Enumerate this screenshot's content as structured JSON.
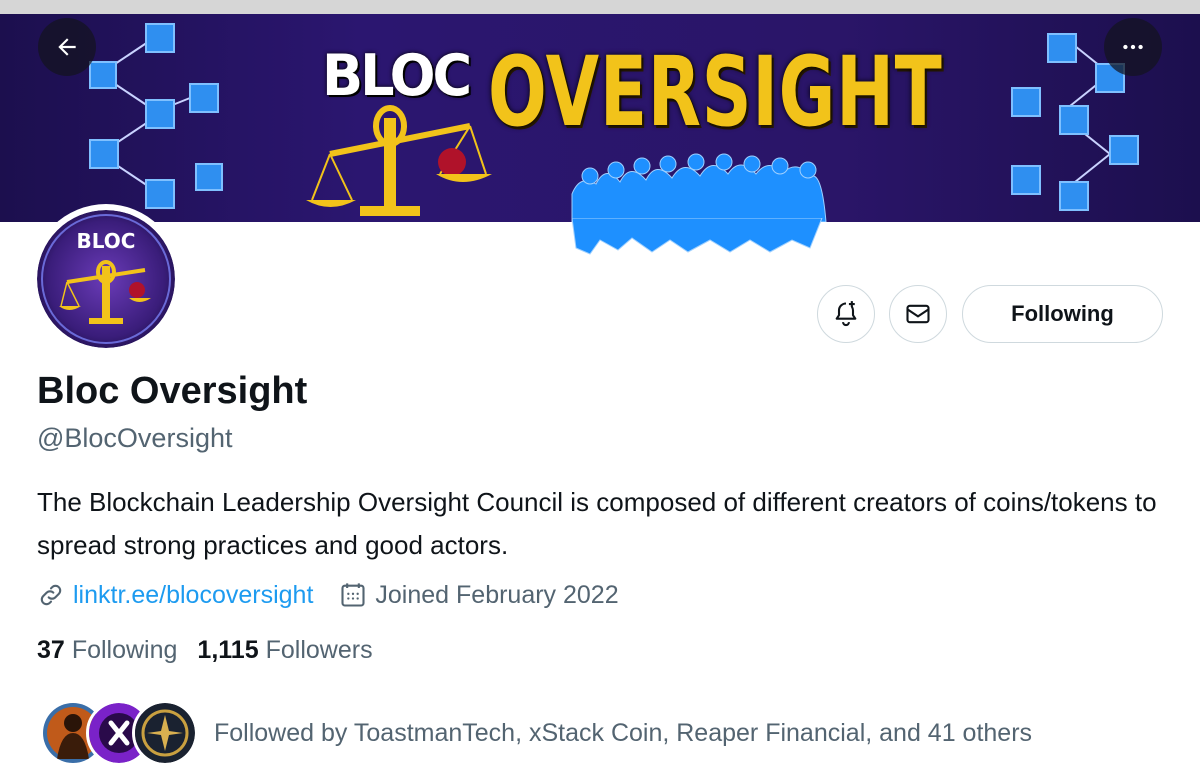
{
  "banner": {
    "word_small": "BLOC",
    "word_large": "OVERSIGHT"
  },
  "nav": {
    "back_icon": "arrow-left-icon",
    "more_icon": "more-horizontal-icon"
  },
  "avatar": {
    "logo_text": "BLOC"
  },
  "actions": {
    "notify_icon": "bell-plus-icon",
    "message_icon": "envelope-icon",
    "following_label": "Following"
  },
  "profile": {
    "display_name": "Bloc Oversight",
    "handle": "@BlocOversight",
    "bio": "The Blockchain Leadership Oversight Council is composed of different creators of coins/tokens to spread strong practices and good actors.",
    "link_text": "linktr.ee/blocoversight",
    "joined_text": "Joined February 2022"
  },
  "stats": {
    "following_count": "37",
    "following_label": "Following",
    "followers_count": "1,115",
    "followers_label": "Followers"
  },
  "followed_by": {
    "text": "Followed by ToastmanTech, xStack Coin, Reaper Financial, and 41 others"
  },
  "colors": {
    "accent_blue": "#1d9bf0",
    "banner_purple": "#2b1670",
    "banner_gold": "#f2c31a",
    "muted_text": "#536471",
    "border": "#cfd9de"
  }
}
